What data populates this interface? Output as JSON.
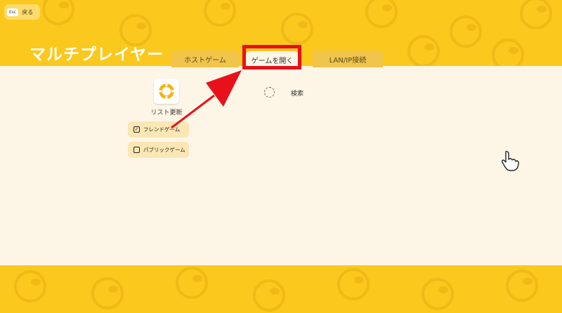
{
  "header": {
    "esc_key": "Esc",
    "back_label": "戻る",
    "title": "マルチプレイヤー"
  },
  "tabs": [
    {
      "label": "ホストゲーム",
      "active": false
    },
    {
      "label": "ゲームを開く",
      "active": true
    },
    {
      "label": "LAN/IP接続",
      "active": false
    }
  ],
  "toolbar": {
    "refresh_label": "リスト更新",
    "search_label": "検索"
  },
  "filters": [
    {
      "label": "フレンドゲーム",
      "checked": true
    },
    {
      "label": "パブリックゲーム",
      "checked": false
    }
  ],
  "colors": {
    "background": "#fbc81e",
    "panel": "#fdf5e6",
    "tab": "#f1c44b",
    "highlight": "#e8101a",
    "refresh_icon": "#f5b400"
  }
}
